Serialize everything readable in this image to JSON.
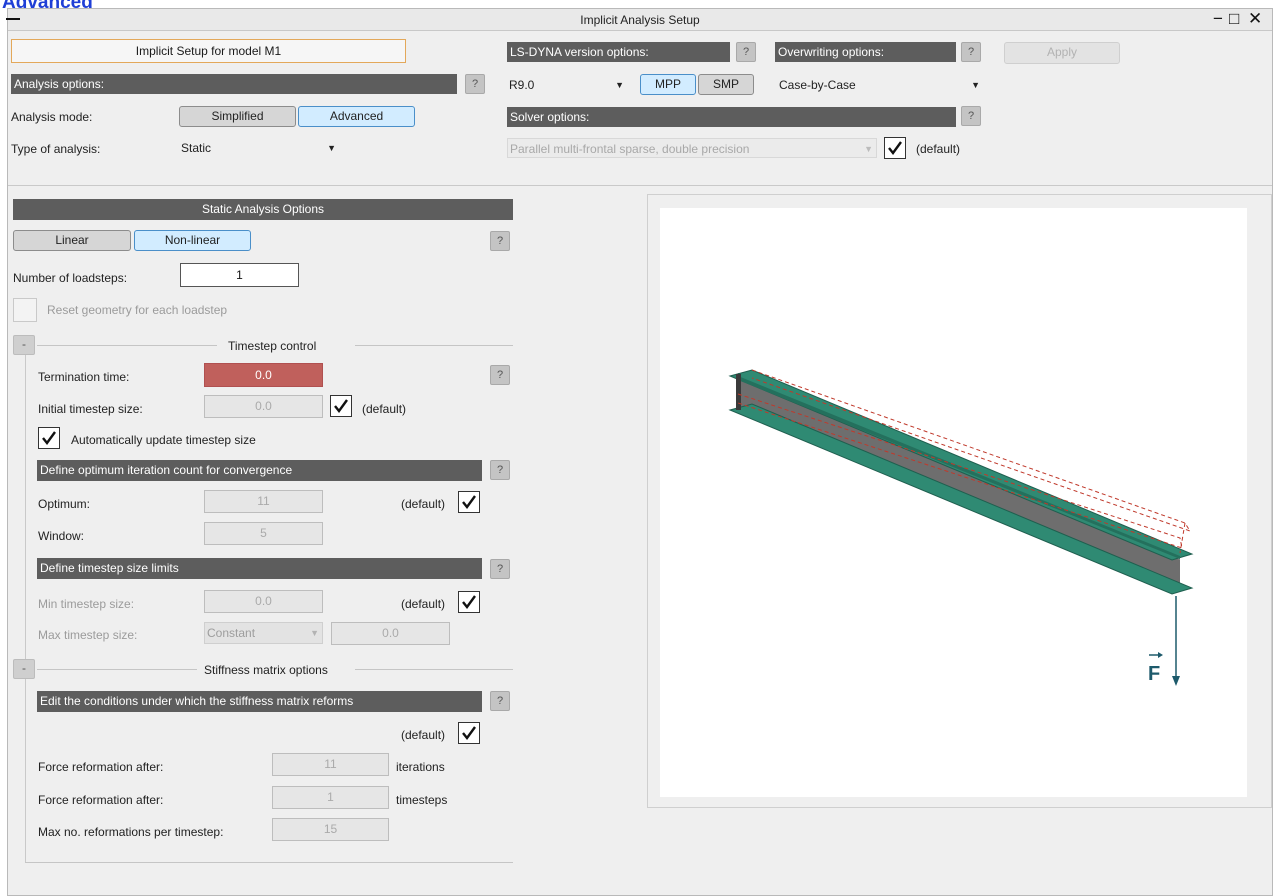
{
  "page_heading": "Advanced",
  "window": {
    "title": "Implicit Analysis Setup",
    "controls": {
      "minimize": "−",
      "maximize": "□",
      "close": "✕"
    }
  },
  "model_setup": {
    "label": "Implicit Setup for model M1"
  },
  "analysis_options": {
    "header": "Analysis options:",
    "mode_label": "Analysis mode:",
    "mode_buttons": [
      "Simplified",
      "Advanced"
    ],
    "mode_selected": "Advanced",
    "type_label": "Type of analysis:",
    "type_value": "Static"
  },
  "lsdyna": {
    "header": "LS-DYNA version options:",
    "version": "R9.0",
    "mpp": "MPP",
    "smp": "SMP",
    "mpp_selected": true
  },
  "overwriting": {
    "header": "Overwriting options:",
    "value": "Case-by-Case",
    "apply": "Apply"
  },
  "solver": {
    "header": "Solver options:",
    "value": "Parallel multi-frontal sparse, double precision",
    "default_label": "(default)",
    "default_checked": true
  },
  "help_label": "?",
  "static": {
    "header": "Static Analysis Options",
    "buttons": [
      "Linear",
      "Non-linear"
    ],
    "selected": "Non-linear",
    "loadsteps_label": "Number of loadsteps:",
    "loadsteps_value": "1",
    "reset_label": "Reset geometry for each loadstep"
  },
  "timestep": {
    "collapse": "-",
    "title": "Timestep control",
    "termination_label": "Termination time:",
    "termination_value": "0.0",
    "initial_label": "Initial timestep size:",
    "initial_value": "0.0",
    "initial_default": "(default)",
    "auto_update_label": "Automatically update timestep size",
    "iter_header": "Define optimum iteration count for convergence",
    "optimum_label": "Optimum:",
    "optimum_value": "11",
    "optimum_default": "(default)",
    "window_label": "Window:",
    "window_value": "5",
    "limits_header": "Define timestep size limits",
    "min_label": "Min timestep size:",
    "min_value": "0.0",
    "min_default": "(default)",
    "max_label": "Max timestep size:",
    "max_mode": "Constant",
    "max_value": "0.0"
  },
  "stiffness": {
    "collapse": "-",
    "title": "Stiffness matrix options",
    "header": "Edit the conditions under which the stiffness matrix reforms",
    "default_label": "(default)",
    "reform_iter_label": "Force reformation after:",
    "reform_iter_value": "11",
    "reform_iter_unit": "iterations",
    "reform_step_label": "Force reformation after:",
    "reform_step_value": "1",
    "reform_step_unit": "timesteps",
    "max_reform_label": "Max no. reformations per timestep:",
    "max_reform_value": "15"
  },
  "viewport": {
    "force_label": "F"
  },
  "colors": {
    "header_bg": "#5d5d5d",
    "selected_bg": "#d2ecff",
    "termination_bg": "#c0605c",
    "beam_flange": "#2f8a73",
    "beam_web": "#6e6e6e",
    "deformed": "#c0392b",
    "force": "#1d5a6b"
  }
}
